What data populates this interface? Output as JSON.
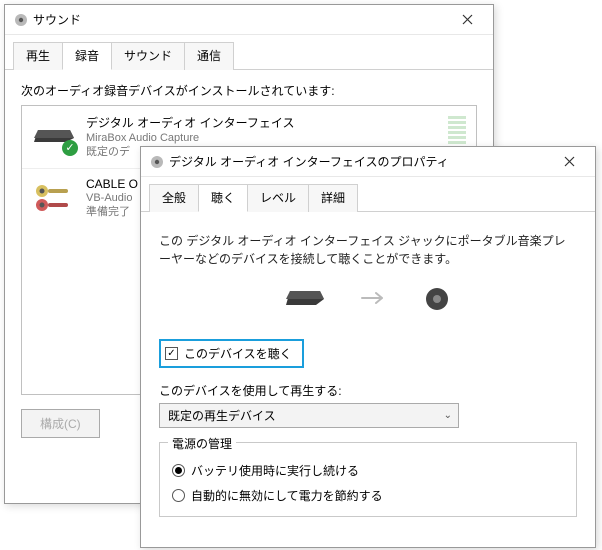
{
  "sound_window": {
    "title": "サウンド",
    "tabs": {
      "playback": "再生",
      "record": "録音",
      "sound": "サウンド",
      "comm": "通信"
    },
    "list_heading": "次のオーディオ録音デバイスがインストールされています:",
    "devices": [
      {
        "title": "デジタル オーディオ インターフェイス",
        "sub1": "MiraBox Audio Capture",
        "sub2": "既定のデ"
      },
      {
        "title": "CABLE O",
        "sub1": "VB-Audio",
        "sub2": "準備完了"
      }
    ],
    "configure_btn": "構成(C)"
  },
  "prop_window": {
    "title": "デジタル オーディオ インターフェイスのプロパティ",
    "tabs": {
      "general": "全般",
      "listen": "聴く",
      "level": "レベル",
      "detail": "詳細"
    },
    "description": "この デジタル オーディオ インターフェイス ジャックにポータブル音楽プレーヤーなどのデバイスを接続して聴くことができます。",
    "listen_checkbox": "このデバイスを聴く",
    "playback_label": "このデバイスを使用して再生する:",
    "playback_value": "既定の再生デバイス",
    "power_legend": "電源の管理",
    "power_opt1": "バッテリ使用時に実行し続ける",
    "power_opt2": "自動的に無効にして電力を節約する"
  }
}
